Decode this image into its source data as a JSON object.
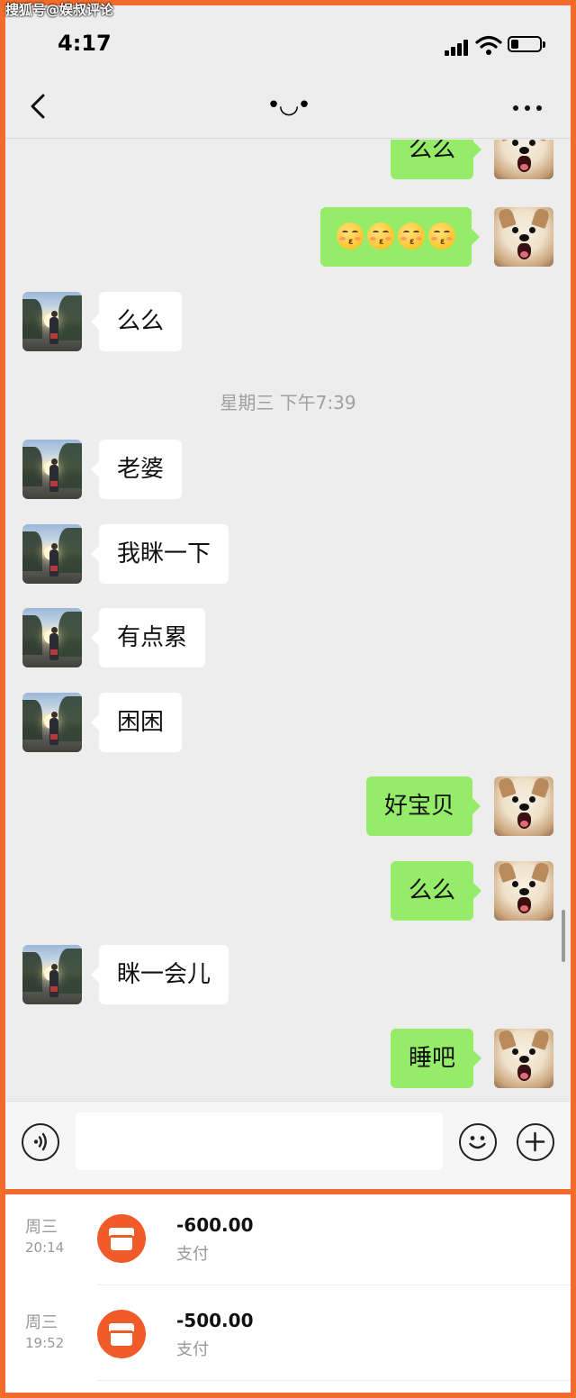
{
  "watermark": "搜狐号@娱叔评论",
  "status_bar": {
    "time": "4:17",
    "battery_level": 0.25
  },
  "nav": {
    "title": "•◡•"
  },
  "messages": [
    {
      "side": "out",
      "text": "么么"
    },
    {
      "side": "out",
      "emoji": [
        "kissing-face-with-closed-eyes",
        "kissing-face-with-closed-eyes",
        "kissing-face-with-closed-eyes",
        "kissing-face-with-closed-eyes"
      ]
    },
    {
      "side": "in",
      "text": "么么"
    },
    {
      "timestamp": "星期三 下午7:39"
    },
    {
      "side": "in",
      "text": "老婆"
    },
    {
      "side": "in",
      "text": "我眯一下"
    },
    {
      "side": "in",
      "text": "有点累"
    },
    {
      "side": "in",
      "text": "困困"
    },
    {
      "side": "out",
      "text": "好宝贝"
    },
    {
      "side": "out",
      "text": "么么"
    },
    {
      "side": "in",
      "text": "眯一会儿"
    },
    {
      "side": "out",
      "text": "睡吧"
    }
  ],
  "input": {
    "value": "",
    "placeholder": ""
  },
  "payments": [
    {
      "day": "周三",
      "time": "20:14",
      "amount": "-600.00",
      "type": "支付",
      "icon": "store-icon"
    },
    {
      "day": "周三",
      "time": "19:52",
      "amount": "-500.00",
      "type": "支付",
      "icon": "store-icon"
    }
  ],
  "colors": {
    "frame": "#f26b2b",
    "chat_background": "#ededed",
    "outgoing_bubble": "#95ec69",
    "incoming_bubble": "#ffffff",
    "payment_icon": "#f15b2a"
  }
}
